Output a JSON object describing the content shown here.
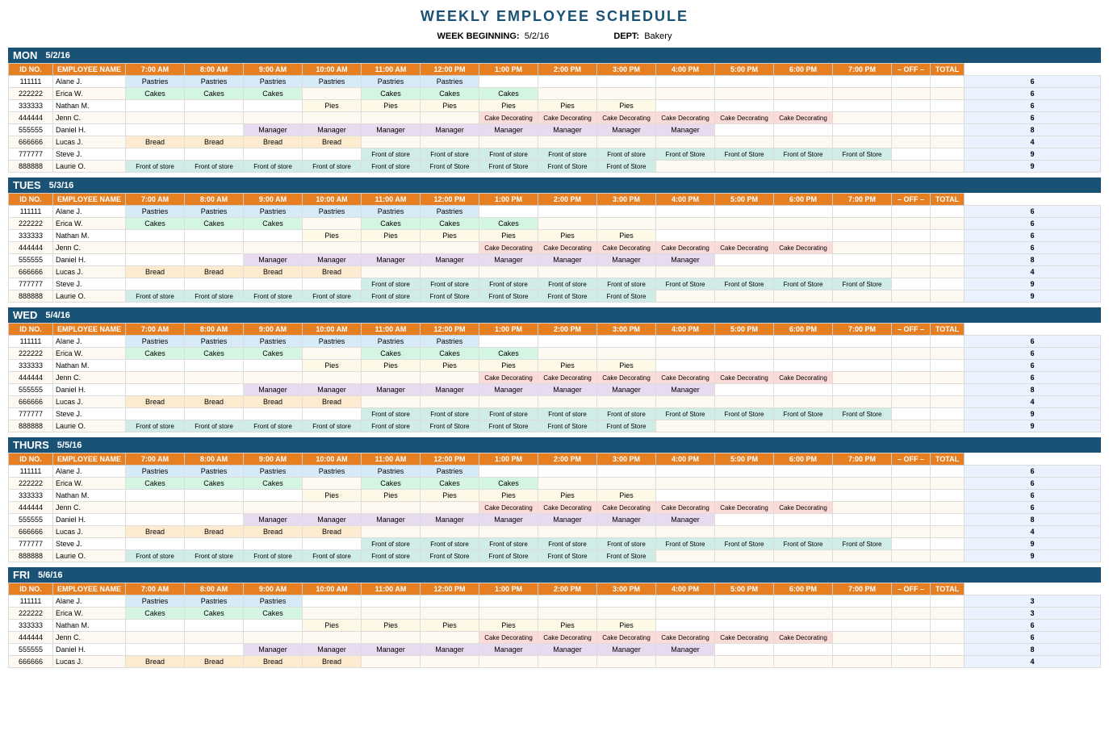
{
  "title": "WEEKLY EMPLOYEE SCHEDULE",
  "meta": {
    "week_label": "WEEK BEGINNING:",
    "week_value": "5/2/16",
    "dept_label": "DEPT:",
    "dept_value": "Bakery"
  },
  "columns": [
    "ID NO.",
    "EMPLOYEE NAME",
    "7:00 AM",
    "8:00 AM",
    "9:00 AM",
    "10:00 AM",
    "11:00 AM",
    "12:00 PM",
    "1:00 PM",
    "2:00 PM",
    "3:00 PM",
    "4:00 PM",
    "5:00 PM",
    "6:00 PM",
    "7:00 PM",
    "– OFF –",
    "TOTAL"
  ],
  "days": [
    {
      "name": "MON",
      "date": "5/2/16",
      "rows": [
        {
          "id": "111111",
          "name": "Alane J.",
          "slots": [
            "Pastries",
            "Pastries",
            "Pastries",
            "Pastries",
            "Pastries",
            "Pastries",
            "",
            "",
            "",
            "",
            "",
            "",
            "",
            "",
            ""
          ],
          "total": "6"
        },
        {
          "id": "222222",
          "name": "Erica W.",
          "slots": [
            "Cakes",
            "Cakes",
            "Cakes",
            "",
            "Cakes",
            "Cakes",
            "Cakes",
            "",
            "",
            "",
            "",
            "",
            "",
            "",
            ""
          ],
          "total": "6"
        },
        {
          "id": "333333",
          "name": "Nathan M.",
          "slots": [
            "",
            "",
            "",
            "Pies",
            "Pies",
            "Pies",
            "Pies",
            "Pies",
            "Pies",
            "",
            "",
            "",
            "",
            "",
            ""
          ],
          "total": "6"
        },
        {
          "id": "444444",
          "name": "Jenn C.",
          "slots": [
            "",
            "",
            "",
            "",
            "",
            "",
            "Cake Decorating",
            "Cake Decorating",
            "Cake Decorating",
            "Cake Decorating",
            "Cake Decorating",
            "Cake Decorating",
            "",
            "",
            ""
          ],
          "total": "6"
        },
        {
          "id": "555555",
          "name": "Daniel H.",
          "slots": [
            "",
            "",
            "Manager",
            "Manager",
            "Manager",
            "Manager",
            "Manager",
            "Manager",
            "Manager",
            "Manager",
            "",
            "",
            "",
            "",
            ""
          ],
          "total": "8"
        },
        {
          "id": "666666",
          "name": "Lucas J.",
          "slots": [
            "Bread",
            "Bread",
            "Bread",
            "Bread",
            "",
            "",
            "",
            "",
            "",
            "",
            "",
            "",
            "",
            "",
            ""
          ],
          "total": "4"
        },
        {
          "id": "777777",
          "name": "Steve J.",
          "slots": [
            "",
            "",
            "",
            "",
            "Front of store",
            "Front of store",
            "Front of store",
            "Front of store",
            "Front of store",
            "Front of Store",
            "Front of Store",
            "Front of Store",
            "Front of Store",
            "",
            ""
          ],
          "total": "9"
        },
        {
          "id": "888888",
          "name": "Laurie O.",
          "slots": [
            "Front of store",
            "Front of store",
            "Front of store",
            "Front of store",
            "Front of store",
            "Front of Store",
            "Front of Store",
            "Front of Store",
            "Front of Store",
            "",
            "",
            "",
            "",
            "",
            ""
          ],
          "total": "9"
        }
      ]
    },
    {
      "name": "TUES",
      "date": "5/3/16",
      "rows": [
        {
          "id": "111111",
          "name": "Alane J.",
          "slots": [
            "Pastries",
            "Pastries",
            "Pastries",
            "Pastries",
            "Pastries",
            "Pastries",
            "",
            "",
            "",
            "",
            "",
            "",
            "",
            "",
            ""
          ],
          "total": "6"
        },
        {
          "id": "222222",
          "name": "Erica W.",
          "slots": [
            "Cakes",
            "Cakes",
            "Cakes",
            "",
            "Cakes",
            "Cakes",
            "Cakes",
            "",
            "",
            "",
            "",
            "",
            "",
            "",
            ""
          ],
          "total": "6"
        },
        {
          "id": "333333",
          "name": "Nathan M.",
          "slots": [
            "",
            "",
            "",
            "Pies",
            "Pies",
            "Pies",
            "Pies",
            "Pies",
            "Pies",
            "",
            "",
            "",
            "",
            "",
            ""
          ],
          "total": "6"
        },
        {
          "id": "444444",
          "name": "Jenn C.",
          "slots": [
            "",
            "",
            "",
            "",
            "",
            "",
            "Cake Decorating",
            "Cake Decorating",
            "Cake Decorating",
            "Cake Decorating",
            "Cake Decorating",
            "Cake Decorating",
            "",
            "",
            ""
          ],
          "total": "6"
        },
        {
          "id": "555555",
          "name": "Daniel H.",
          "slots": [
            "",
            "",
            "Manager",
            "Manager",
            "Manager",
            "Manager",
            "Manager",
            "Manager",
            "Manager",
            "Manager",
            "",
            "",
            "",
            "",
            ""
          ],
          "total": "8"
        },
        {
          "id": "666666",
          "name": "Lucas J.",
          "slots": [
            "Bread",
            "Bread",
            "Bread",
            "Bread",
            "",
            "",
            "",
            "",
            "",
            "",
            "",
            "",
            "",
            "",
            ""
          ],
          "total": "4"
        },
        {
          "id": "777777",
          "name": "Steve J.",
          "slots": [
            "",
            "",
            "",
            "",
            "Front of store",
            "Front of store",
            "Front of store",
            "Front of store",
            "Front of store",
            "Front of Store",
            "Front of Store",
            "Front of Store",
            "Front of Store",
            "",
            ""
          ],
          "total": "9"
        },
        {
          "id": "888888",
          "name": "Laurie O.",
          "slots": [
            "Front of store",
            "Front of store",
            "Front of store",
            "Front of store",
            "Front of store",
            "Front of Store",
            "Front of Store",
            "Front of Store",
            "Front of Store",
            "",
            "",
            "",
            "",
            "",
            ""
          ],
          "total": "9"
        }
      ]
    },
    {
      "name": "WED",
      "date": "5/4/16",
      "rows": [
        {
          "id": "111111",
          "name": "Alane J.",
          "slots": [
            "Pastries",
            "Pastries",
            "Pastries",
            "Pastries",
            "Pastries",
            "Pastries",
            "",
            "",
            "",
            "",
            "",
            "",
            "",
            "",
            ""
          ],
          "total": "6"
        },
        {
          "id": "222222",
          "name": "Erica W.",
          "slots": [
            "Cakes",
            "Cakes",
            "Cakes",
            "",
            "Cakes",
            "Cakes",
            "Cakes",
            "",
            "",
            "",
            "",
            "",
            "",
            "",
            ""
          ],
          "total": "6"
        },
        {
          "id": "333333",
          "name": "Nathan M.",
          "slots": [
            "",
            "",
            "",
            "Pies",
            "Pies",
            "Pies",
            "Pies",
            "Pies",
            "Pies",
            "",
            "",
            "",
            "",
            "",
            ""
          ],
          "total": "6"
        },
        {
          "id": "444444",
          "name": "Jenn C.",
          "slots": [
            "",
            "",
            "",
            "",
            "",
            "",
            "Cake Decorating",
            "Cake Decorating",
            "Cake Decorating",
            "Cake Decorating",
            "Cake Decorating",
            "Cake Decorating",
            "",
            "",
            ""
          ],
          "total": "6"
        },
        {
          "id": "555555",
          "name": "Daniel H.",
          "slots": [
            "",
            "",
            "Manager",
            "Manager",
            "Manager",
            "Manager",
            "Manager",
            "Manager",
            "Manager",
            "Manager",
            "",
            "",
            "",
            "",
            ""
          ],
          "total": "8"
        },
        {
          "id": "666666",
          "name": "Lucas J.",
          "slots": [
            "Bread",
            "Bread",
            "Bread",
            "Bread",
            "",
            "",
            "",
            "",
            "",
            "",
            "",
            "",
            "",
            "",
            ""
          ],
          "total": "4"
        },
        {
          "id": "777777",
          "name": "Steve J.",
          "slots": [
            "",
            "",
            "",
            "",
            "Front of store",
            "Front of store",
            "Front of store",
            "Front of store",
            "Front of store",
            "Front of Store",
            "Front of Store",
            "Front of Store",
            "Front of Store",
            "",
            ""
          ],
          "total": "9"
        },
        {
          "id": "888888",
          "name": "Laurie O.",
          "slots": [
            "Front of store",
            "Front of store",
            "Front of store",
            "Front of store",
            "Front of store",
            "Front of Store",
            "Front of Store",
            "Front of Store",
            "Front of Store",
            "",
            "",
            "",
            "",
            "",
            ""
          ],
          "total": "9"
        }
      ]
    },
    {
      "name": "THURS",
      "date": "5/5/16",
      "rows": [
        {
          "id": "111111",
          "name": "Alane J.",
          "slots": [
            "Pastries",
            "Pastries",
            "Pastries",
            "Pastries",
            "Pastries",
            "Pastries",
            "",
            "",
            "",
            "",
            "",
            "",
            "",
            "",
            ""
          ],
          "total": "6"
        },
        {
          "id": "222222",
          "name": "Erica W.",
          "slots": [
            "Cakes",
            "Cakes",
            "Cakes",
            "",
            "Cakes",
            "Cakes",
            "Cakes",
            "",
            "",
            "",
            "",
            "",
            "",
            "",
            ""
          ],
          "total": "6"
        },
        {
          "id": "333333",
          "name": "Nathan M.",
          "slots": [
            "",
            "",
            "",
            "Pies",
            "Pies",
            "Pies",
            "Pies",
            "Pies",
            "Pies",
            "",
            "",
            "",
            "",
            "",
            ""
          ],
          "total": "6"
        },
        {
          "id": "444444",
          "name": "Jenn C.",
          "slots": [
            "",
            "",
            "",
            "",
            "",
            "",
            "Cake Decorating",
            "Cake Decorating",
            "Cake Decorating",
            "Cake Decorating",
            "Cake Decorating",
            "Cake Decorating",
            "",
            "",
            ""
          ],
          "total": "6"
        },
        {
          "id": "555555",
          "name": "Daniel H.",
          "slots": [
            "",
            "",
            "Manager",
            "Manager",
            "Manager",
            "Manager",
            "Manager",
            "Manager",
            "Manager",
            "Manager",
            "",
            "",
            "",
            "",
            ""
          ],
          "total": "8"
        },
        {
          "id": "666666",
          "name": "Lucas J.",
          "slots": [
            "Bread",
            "Bread",
            "Bread",
            "Bread",
            "",
            "",
            "",
            "",
            "",
            "",
            "",
            "",
            "",
            "",
            ""
          ],
          "total": "4"
        },
        {
          "id": "777777",
          "name": "Steve J.",
          "slots": [
            "",
            "",
            "",
            "",
            "Front of store",
            "Front of store",
            "Front of store",
            "Front of store",
            "Front of store",
            "Front of Store",
            "Front of Store",
            "Front of Store",
            "Front of Store",
            "",
            ""
          ],
          "total": "9"
        },
        {
          "id": "888888",
          "name": "Laurie O.",
          "slots": [
            "Front of store",
            "Front of store",
            "Front of store",
            "Front of store",
            "Front of store",
            "Front of Store",
            "Front of Store",
            "Front of Store",
            "Front of Store",
            "",
            "",
            "",
            "",
            "",
            ""
          ],
          "total": "9"
        }
      ]
    },
    {
      "name": "FRI",
      "date": "5/6/16",
      "rows": [
        {
          "id": "111111",
          "name": "Alane J.",
          "slots": [
            "Pastries",
            "Pastries",
            "Pastries",
            "",
            "",
            "",
            "",
            "",
            "",
            "",
            "",
            "",
            "",
            "",
            ""
          ],
          "total": "3"
        },
        {
          "id": "222222",
          "name": "Erica W.",
          "slots": [
            "Cakes",
            "Cakes",
            "Cakes",
            "",
            "",
            "",
            "",
            "",
            "",
            "",
            "",
            "",
            "",
            "",
            ""
          ],
          "total": "3"
        },
        {
          "id": "333333",
          "name": "Nathan M.",
          "slots": [
            "",
            "",
            "",
            "Pies",
            "Pies",
            "Pies",
            "Pies",
            "Pies",
            "Pies",
            "",
            "",
            "",
            "",
            "",
            ""
          ],
          "total": "6"
        },
        {
          "id": "444444",
          "name": "Jenn C.",
          "slots": [
            "",
            "",
            "",
            "",
            "",
            "",
            "Cake Decorating",
            "Cake Decorating",
            "Cake Decorating",
            "Cake Decorating",
            "Cake Decorating",
            "Cake Decorating",
            "",
            "",
            ""
          ],
          "total": "6"
        },
        {
          "id": "555555",
          "name": "Daniel H.",
          "slots": [
            "",
            "",
            "Manager",
            "Manager",
            "Manager",
            "Manager",
            "Manager",
            "Manager",
            "Manager",
            "Manager",
            "",
            "",
            "",
            "",
            ""
          ],
          "total": "8"
        },
        {
          "id": "666666",
          "name": "Lucas J.",
          "slots": [
            "Bread",
            "Bread",
            "Bread",
            "Bread",
            "",
            "",
            "",
            "",
            "",
            "",
            "",
            "",
            "",
            "",
            ""
          ],
          "total": "4"
        }
      ]
    }
  ]
}
